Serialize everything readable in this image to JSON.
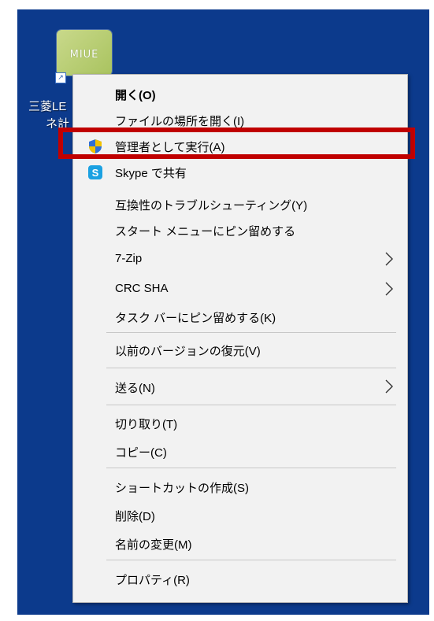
{
  "desktop": {
    "icon_text": "MIUE",
    "label_line1": "三菱LE",
    "label_line2": "ネ計"
  },
  "menu": {
    "items": [
      {
        "label": "開く(O)",
        "bold": true
      },
      {
        "label": "ファイルの場所を開く(I)"
      },
      {
        "label": "管理者として実行(A)",
        "icon": "uac-shield-icon"
      },
      {
        "label": "Skype で共有",
        "icon": "skype-icon"
      },
      {
        "label": "互換性のトラブルシューティング(Y)"
      },
      {
        "label": "スタート メニューにピン留めする"
      },
      {
        "label": "7-Zip",
        "submenu": true
      },
      {
        "label": "CRC SHA",
        "submenu": true
      },
      {
        "label": "タスク バーにピン留めする(K)"
      },
      {
        "label": "以前のバージョンの復元(V)"
      },
      {
        "label": "送る(N)",
        "submenu": true
      },
      {
        "label": "切り取り(T)"
      },
      {
        "label": "コピー(C)"
      },
      {
        "label": "ショートカットの作成(S)"
      },
      {
        "label": "削除(D)"
      },
      {
        "label": "名前の変更(M)"
      },
      {
        "label": "プロパティ(R)"
      }
    ]
  },
  "colors": {
    "desktop": "#0c3a8c",
    "menu_bg": "#f2f2f2",
    "highlight": "#c00000",
    "separator": "#c8c8c8"
  }
}
